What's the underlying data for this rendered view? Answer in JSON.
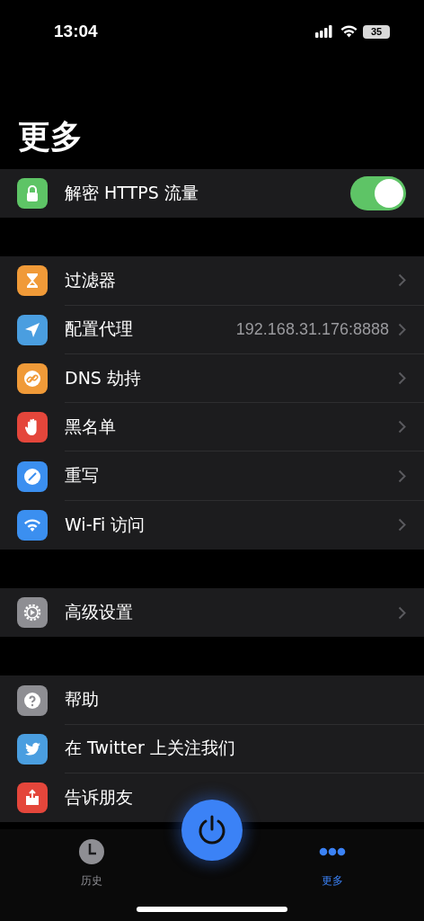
{
  "status_bar": {
    "time": "13:04",
    "battery": "35"
  },
  "title": "更多",
  "groups": [
    {
      "rows": [
        {
          "kind": "toggle",
          "label": "解密 HTTPS 流量",
          "color": "#5ec466",
          "on": true
        }
      ]
    },
    {
      "rows": [
        {
          "kind": "link",
          "label": "过滤器",
          "color": "#f09a38",
          "chevron": true
        },
        {
          "kind": "link",
          "label": "配置代理",
          "value": "192.168.31.176:8888",
          "color": "#4a9ee0",
          "chevron": true
        },
        {
          "kind": "link",
          "label": "DNS 劫持",
          "color": "#f09a38",
          "chevron": true
        },
        {
          "kind": "link",
          "label": "黑名单",
          "color": "#e4463b",
          "chevron": true
        },
        {
          "kind": "link",
          "label": "重写",
          "color": "#3b8ff0",
          "chevron": true
        },
        {
          "kind": "link",
          "label": "Wi-Fi 访问",
          "color": "#3b8ff0",
          "chevron": true
        }
      ]
    },
    {
      "rows": [
        {
          "kind": "link",
          "label": "高级设置",
          "color": "#8e8e93",
          "chevron": true
        }
      ]
    },
    {
      "rows": [
        {
          "kind": "link",
          "label": "帮助",
          "color": "#8e8e93",
          "chevron": false
        },
        {
          "kind": "link",
          "label": "在 Twitter 上关注我们",
          "color": "#4a9ee0",
          "chevron": false
        },
        {
          "kind": "link",
          "label": "告诉朋友",
          "color": "#e4463b",
          "chevron": false
        }
      ]
    }
  ],
  "tabs": [
    {
      "label": "历史",
      "selected": false
    },
    {
      "label": "更多",
      "selected": true
    }
  ]
}
